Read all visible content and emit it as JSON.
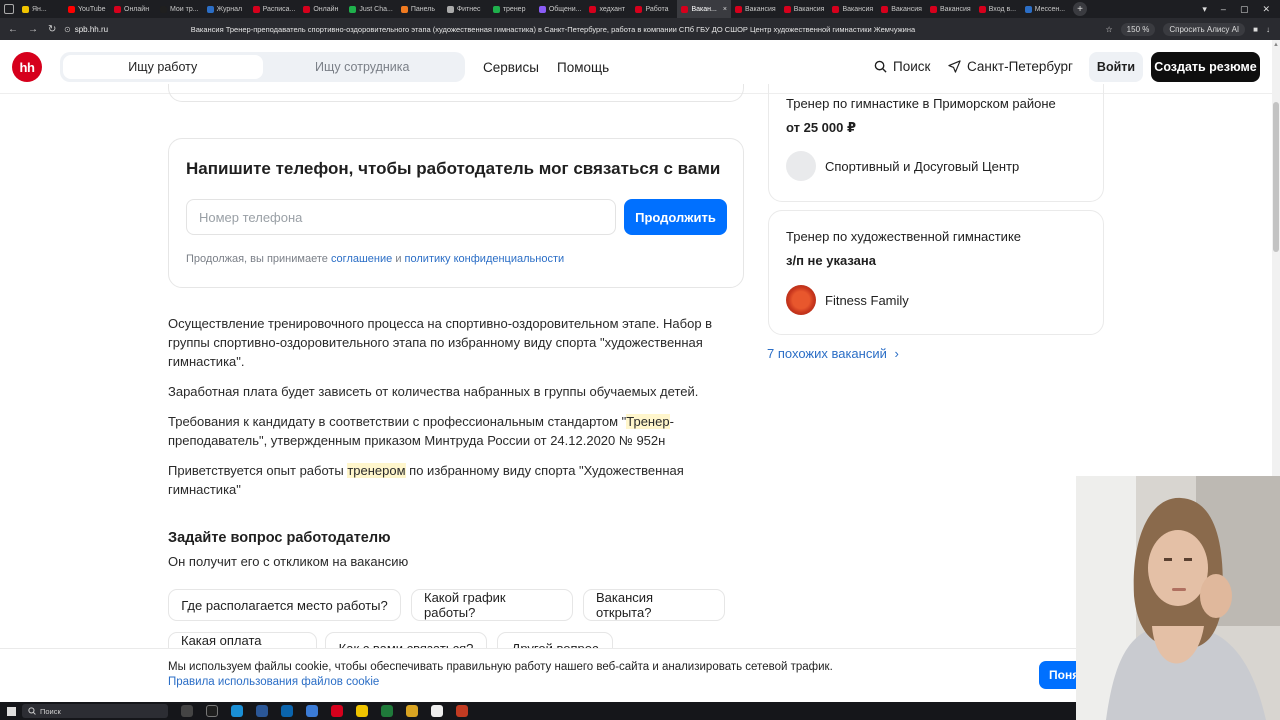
{
  "browser": {
    "tabs": [
      {
        "label": "Ян...",
        "color": "#f0c400"
      },
      {
        "label": "YouTube",
        "color": "#ff0000"
      },
      {
        "label": "Онлайн",
        "color": "#d6001c"
      },
      {
        "label": "Мои тр...",
        "color": "#1f1f1f"
      },
      {
        "label": "Журнал",
        "color": "#2b6ec6"
      },
      {
        "label": "Расписа...",
        "color": "#d6001c"
      },
      {
        "label": "Онлайн",
        "color": "#d6001c"
      },
      {
        "label": "Just Cha...",
        "color": "#1fb04c"
      },
      {
        "label": "Панель",
        "color": "#f07a20"
      },
      {
        "label": "Фитнес",
        "color": "#aaaaaa"
      },
      {
        "label": "тренер",
        "color": "#1fb04c"
      },
      {
        "label": "Общени...",
        "color": "#8a5cf6"
      },
      {
        "label": "хедхант",
        "color": "#d6001c"
      },
      {
        "label": "Работа",
        "color": "#d6001c"
      },
      {
        "label": "Вакан...",
        "color": "#d6001c",
        "active": true
      },
      {
        "label": "Вакансия",
        "color": "#d6001c"
      },
      {
        "label": "Вакансия",
        "color": "#d6001c"
      },
      {
        "label": "Вакансия",
        "color": "#d6001c"
      },
      {
        "label": "Вакансия",
        "color": "#d6001c"
      },
      {
        "label": "Вакансия",
        "color": "#d6001c"
      },
      {
        "label": "Вход в...",
        "color": "#d6001c"
      },
      {
        "label": "Мессен...",
        "color": "#2b6ec6"
      }
    ],
    "url": "spb.hh.ru",
    "page_title": "Вакансия Тренер-преподаватель спортивно-оздоровительного этапа (художественная гимнастика) в Санкт-Петербурге, работа в компании СПб ГБУ ДО СШОР Центр художественной гимнастики Жемчужина",
    "zoom": "150 %",
    "alice": "Спросить Алису AI"
  },
  "header": {
    "logo": "hh",
    "seg_jobseeker": "Ищу работу",
    "seg_employer": "Ищу сотрудника",
    "services": "Сервисы",
    "help": "Помощь",
    "search": "Поиск",
    "city": "Санкт-Петербург",
    "login": "Войти",
    "create_resume": "Создать резюме"
  },
  "phone_form": {
    "title": "Напишите телефон, чтобы работодатель мог связаться с вами",
    "placeholder": "Номер телефона",
    "submit": "Продолжить",
    "agree_prefix": "Продолжая, вы принимаете",
    "agree_link1": "соглашение",
    "agree_and": "и",
    "agree_link2": "политику конфиденциальности"
  },
  "description": {
    "p1": "Осуществление тренировочного процесса на спортивно-оздоровительном этапе. Набор в группы спортивно-оздоровительного этапа по избранному виду спорта \"художественная гимнастика\".",
    "p2": "Заработная плата будет зависеть от количества набранных в группы обучаемых детей.",
    "p3_a": "Требования к кандидату в соответствии с профессиональным стандартом \"",
    "p3_hl": "Тренер",
    "p3_b": "-преподаватель\", утвержденным приказом Минтруда России от 24.12.2020 № 952н",
    "p4_a": "Приветствуется опыт работы ",
    "p4_hl": "тренером",
    "p4_b": " по избранному виду спорта \"Художественная гимнастика\""
  },
  "ask": {
    "title": "Задайте вопрос работодателю",
    "subtitle": "Он получит его с откликом на вакансию",
    "chips": [
      "Где располагается место работы?",
      "Какой график работы?",
      "Вакансия открыта?",
      "Какая оплата труда?",
      "Как с вами связаться?",
      "Другой вопрос"
    ]
  },
  "similar": {
    "cards": [
      {
        "title": "Тренер по гимнастике в Приморском районе",
        "salary": "от 25 000 ₽",
        "company": "Спортивный и Досуговый Центр"
      },
      {
        "title": "Тренер по художественной гимнастике",
        "salary": "з/п не указана",
        "company": "Fitness Family"
      }
    ],
    "more": "7 похожих вакансий"
  },
  "cookie": {
    "text": "Мы используем файлы cookie, чтобы обеспечивать правильную работу нашего веб-сайта и анализировать сетевой трафик.",
    "link": "Правила использования файлов cookie",
    "ok": "Поня"
  },
  "taskbar": {
    "search": "Поиск"
  }
}
